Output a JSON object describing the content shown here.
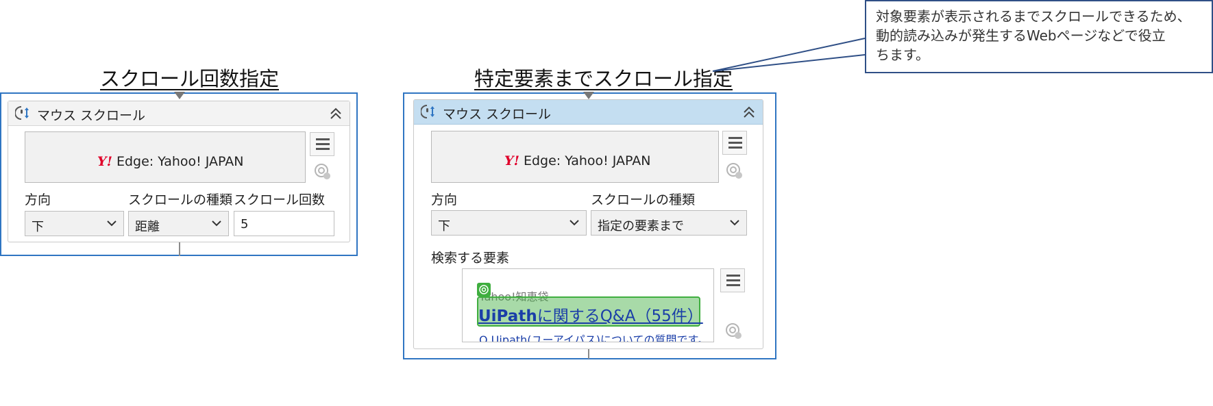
{
  "left_panel": {
    "heading": "スクロール回数指定",
    "activity": {
      "title": "マウス スクロール",
      "icon": "mouse-scroll-icon",
      "target": {
        "logo": "Y!",
        "text": "Edge: Yahoo! JAPAN"
      },
      "fields": {
        "direction_label": "方向",
        "direction_value": "下",
        "type_label": "スクロールの種類",
        "type_value": "距離",
        "count_label": "スクロール回数",
        "count_value": "5"
      }
    }
  },
  "right_panel": {
    "heading": "特定要素までスクロール指定",
    "activity": {
      "title": "マウス スクロール",
      "icon": "mouse-scroll-icon",
      "target": {
        "logo": "Y!",
        "text": "Edge: Yahoo! JAPAN"
      },
      "fields": {
        "direction_label": "方向",
        "direction_value": "下",
        "type_label": "スクロールの種類",
        "type_value": "指定の要素まで"
      },
      "search_element": {
        "label": "検索する要素",
        "screenshot": {
          "site_text": "Yahoo!知恵袋",
          "link_brand": "UiPath",
          "link_rest": "に関するQ&A（55件）",
          "sub_text": "Q Uipath(ユーアイパス)についての質問です。"
        }
      }
    }
  },
  "callout": {
    "lines": [
      "対象要素が表示されるまでスクロールできるため、",
      "動的読み込みが発生するWebページなどで役立",
      "ちます。"
    ]
  },
  "colors": {
    "outer_border": "#2f75c2",
    "selected_header": "#c4def1",
    "highlight_green": "#3fae3f",
    "yahoo_red": "#e0002a",
    "link_blue": "#1a3ea8"
  }
}
